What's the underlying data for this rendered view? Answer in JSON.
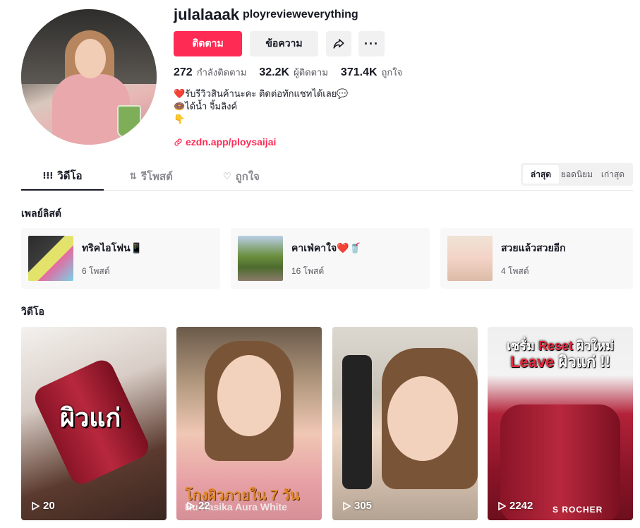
{
  "profile": {
    "username": "julalaaak",
    "nickname": "ployrevieweverything",
    "follow_label": "ติดตาม",
    "message_label": "ข้อความ",
    "more_label": "···",
    "stats": [
      {
        "value": "272",
        "label": "กำลังติดตาม"
      },
      {
        "value": "32.2K",
        "label": "ผู้ติดตาม"
      },
      {
        "value": "371.4K",
        "label": "ถูกใจ"
      }
    ],
    "bio": [
      "❤️รับรีวิวสินค้านะคะ ติดต่อทักแชทได้เลย💬",
      "🍩ได้น้ำ จิ้มลิงค์",
      "👇"
    ],
    "link": "ezdn.app/ploysaijai"
  },
  "tabs": [
    {
      "label": "วิดีโอ",
      "icon": "grid-icon"
    },
    {
      "label": "รีโพสต์",
      "icon": "repost-icon"
    },
    {
      "label": "ถูกใจ",
      "icon": "heart-icon"
    }
  ],
  "sort": [
    "ล่าสุด",
    "ยอดนิยม",
    "เก่าสุด"
  ],
  "playlists_title": "เพลย์ลิสต์",
  "playlists": [
    {
      "name": "ทริคไอโฟน📱",
      "count": "6 โพสต์"
    },
    {
      "name": "คาเฟ่คาใจ❤️🥤",
      "count": "16 โพสต์"
    },
    {
      "name": "สวยแล้วสวยอีก",
      "count": "4 โพสต์"
    }
  ],
  "videos_title": "วิดีโอ",
  "videos": [
    {
      "views": "20",
      "overlay": "ผิวแก่"
    },
    {
      "views": "22",
      "overlay": "โกงผิวภายใน 7 วัน",
      "overlay_sub": "Hu Rasika Aura White"
    },
    {
      "views": "305"
    },
    {
      "views": "2242",
      "overlay_line1_a": "เซรั่ม ",
      "overlay_line1_b": "Reset",
      "overlay_line1_c": " ผิวใหม่",
      "overlay_line2_a": "Leave",
      "overlay_line2_b": " ผิวแก่ !!",
      "brand": "S ROCHER"
    }
  ],
  "colors": {
    "accent": "#fe2c55",
    "text": "#161823",
    "muted": "#595a61"
  }
}
